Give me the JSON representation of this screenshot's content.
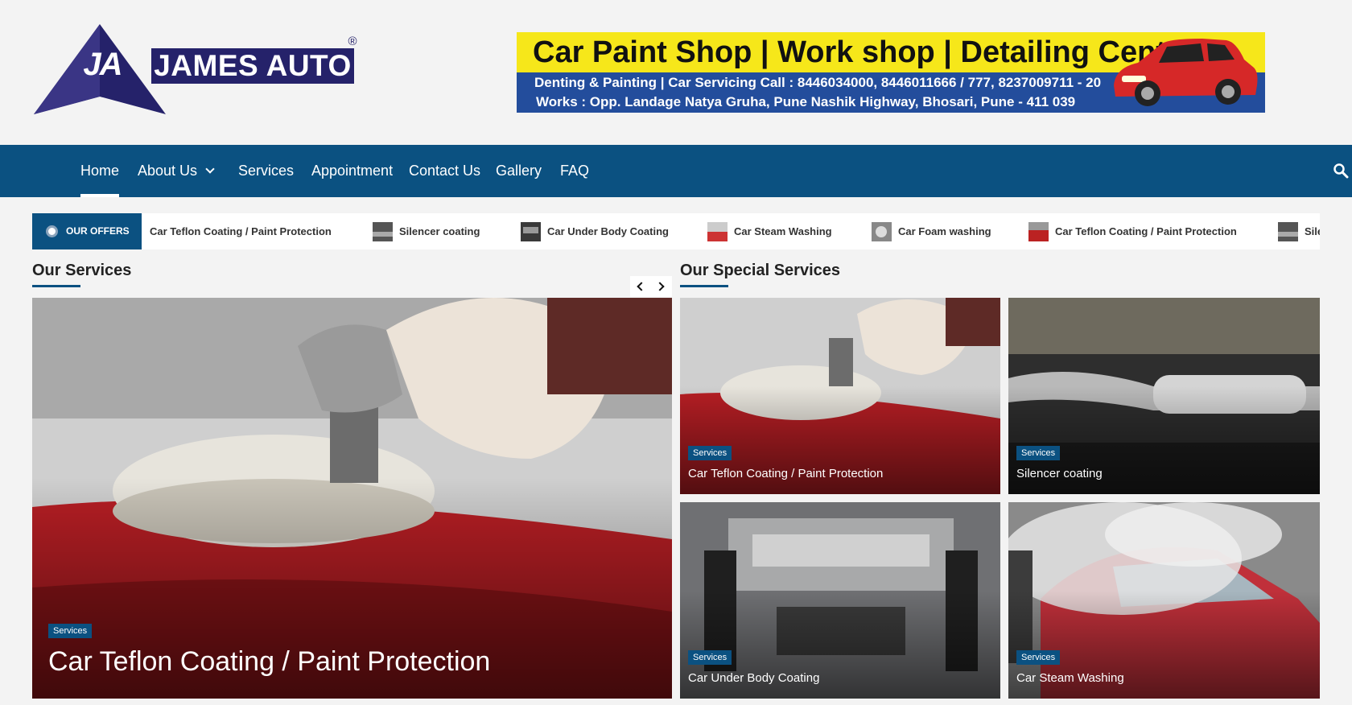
{
  "brand": {
    "initials": "JA",
    "name": "JAMES AUTO",
    "registered": "®",
    "colors": {
      "navy": "#25226a",
      "nav": "#0b5181"
    }
  },
  "banner": {
    "title": "Car Paint Shop | Work shop | Detailing Centre",
    "line2": "Denting & Painting  |  Car Servicing     Call : 8446034000, 8446011666 / 777, 8237009711 - 20",
    "line3": "Works : Opp. Landage Natya Gruha, Pune Nashik Highway, Bhosari, Pune - 411 039"
  },
  "nav": {
    "items": [
      {
        "label": "Home"
      },
      {
        "label": "About Us"
      },
      {
        "label": "Services"
      },
      {
        "label": "Appointment"
      },
      {
        "label": "Contact Us"
      },
      {
        "label": "Gallery"
      },
      {
        "label": "FAQ"
      }
    ],
    "search_icon": "search-icon"
  },
  "ticker": {
    "label": "OUR OFFERS",
    "items": [
      {
        "label": "Car Teflon Coating / Paint Protection"
      },
      {
        "label": "Silencer coating"
      },
      {
        "label": "Car Under Body Coating"
      },
      {
        "label": "Car Steam Washing"
      },
      {
        "label": "Car Foam washing"
      },
      {
        "label": "Car Teflon Coating / Paint Protection"
      },
      {
        "label": "Sile"
      }
    ]
  },
  "our_services": {
    "title": "Our Services",
    "featured": {
      "badge": "Services",
      "title": "Car Teflon Coating / Paint Protection"
    }
  },
  "special_services": {
    "title": "Our Special Services",
    "cards": [
      {
        "badge": "Services",
        "title": "Car Teflon Coating / Paint Protection"
      },
      {
        "badge": "Services",
        "title": "Silencer coating"
      },
      {
        "badge": "Services",
        "title": "Car Under Body Coating"
      },
      {
        "badge": "Services",
        "title": "Car Steam Washing"
      }
    ]
  }
}
